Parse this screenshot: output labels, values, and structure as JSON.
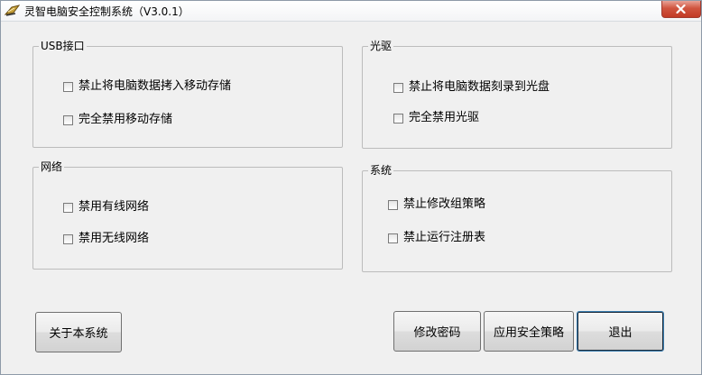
{
  "window": {
    "title": "灵智电脑安全控制系统（V3.0.1）"
  },
  "groups": {
    "usb": {
      "label": "USB接口",
      "options": [
        "禁止将电脑数据拷入移动存储",
        "完全禁用移动存储"
      ]
    },
    "optical": {
      "label": "光驱",
      "options": [
        "禁止将电脑数据刻录到光盘",
        "完全禁用光驱"
      ]
    },
    "network": {
      "label": "网络",
      "options": [
        "禁用有线网络",
        "禁用无线网络"
      ]
    },
    "system": {
      "label": "系统",
      "options": [
        "禁止修改组策略",
        "禁止运行注册表"
      ]
    }
  },
  "buttons": {
    "about": "关于本系统",
    "change_password": "修改密码",
    "apply_policy": "应用安全策略",
    "exit": "退出"
  },
  "colors": {
    "close_button": "#c9432d",
    "border": "#bcbcbc"
  }
}
